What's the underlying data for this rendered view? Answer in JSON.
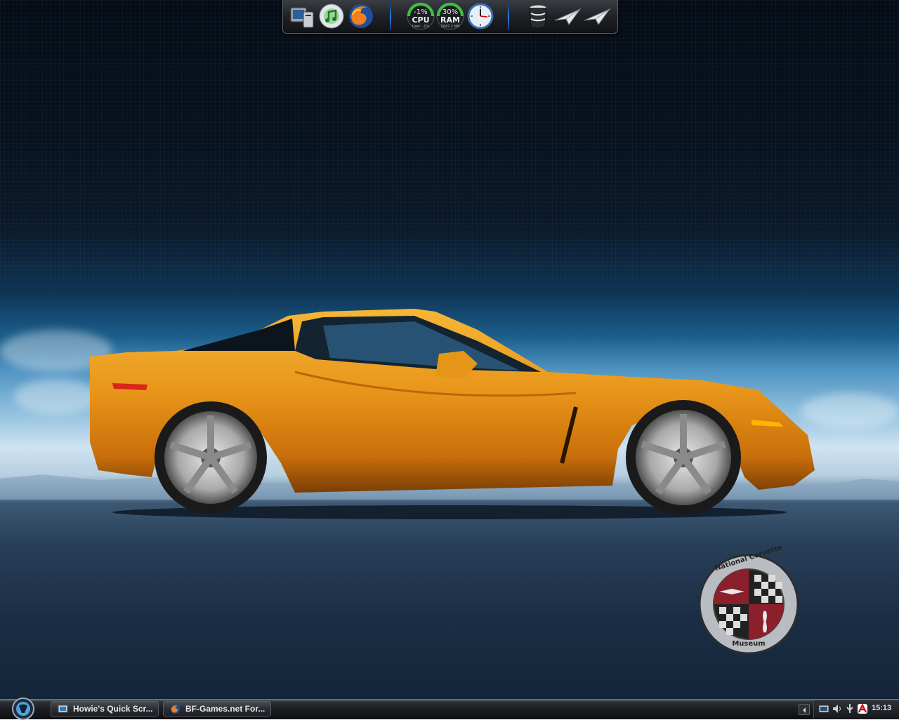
{
  "dock": {
    "icons": [
      "my-computer-icon",
      "itunes-icon",
      "firefox-icon"
    ],
    "cpu_gauge": {
      "value": "-1%",
      "label": "CPU",
      "sub": "User: -1%",
      "color": "#3cc23c"
    },
    "ram_gauge": {
      "value": "30%",
      "label": "RAM",
      "sub": "2047.2 MB",
      "color": "#3cc23c"
    },
    "right_icons": [
      "clock-icon",
      "recycle-bin-icon",
      "paper-plane-icon",
      "paper-plane-icon"
    ]
  },
  "wallpaper": {
    "subject": "orange sports car",
    "car_color": "#e89a1a",
    "logo_text_top": "National Corvette",
    "logo_text_bottom": "Museum"
  },
  "taskbar": {
    "tasks": [
      {
        "label": "Howie's Quick Scr...",
        "icon": "screenshot-app-icon"
      },
      {
        "label": "BF-Games.net For...",
        "icon": "firefox-icon"
      }
    ],
    "clock": "15:13",
    "tray_icons": [
      "network-icon",
      "volume-icon",
      "usb-icon",
      "antivirus-icon"
    ]
  }
}
